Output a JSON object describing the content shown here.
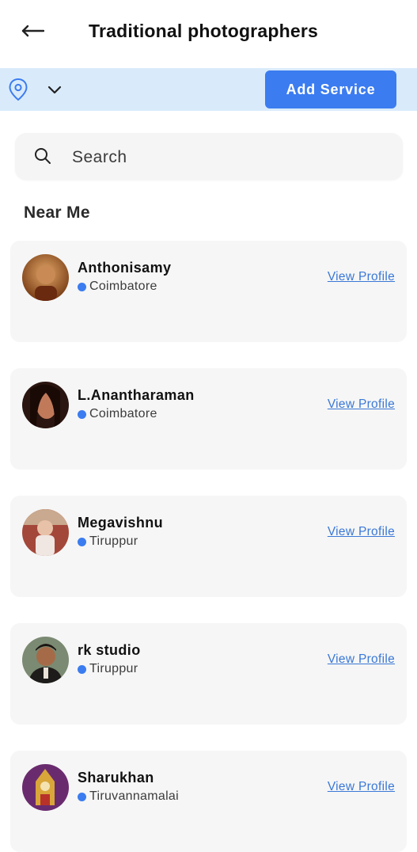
{
  "header": {
    "back_icon": "back-arrow-icon",
    "title": "Traditional photographers"
  },
  "location_bar": {
    "location_icon": "map-pin-icon",
    "dropdown_icon": "chevron-down-icon",
    "add_service_label": "Add Service",
    "background_color": "#d9ebfb",
    "button_color": "#3b7cf0"
  },
  "search": {
    "icon": "search-icon",
    "placeholder": "Search"
  },
  "section": {
    "title": "Near Me"
  },
  "listings": [
    {
      "name": "Anthonisamy",
      "location": "Coimbatore",
      "action": "View Profile",
      "avatar_colors": [
        "#8a4a1e",
        "#d99a55"
      ]
    },
    {
      "name": "L.Anantharaman",
      "location": "Coimbatore",
      "action": "View Profile",
      "avatar_colors": [
        "#2a1510",
        "#c07a5a"
      ]
    },
    {
      "name": "Megavishnu",
      "location": "Tiruppur",
      "action": "View Profile",
      "avatar_colors": [
        "#a3473a",
        "#f0e6e2"
      ]
    },
    {
      "name": "rk studio",
      "location": "Tiruppur",
      "action": "View Profile",
      "avatar_colors": [
        "#5a6b55",
        "#2a2724"
      ]
    },
    {
      "name": "Sharukhan",
      "location": "Tiruvannamalai",
      "action": "View Profile",
      "avatar_colors": [
        "#6a2b6e",
        "#d9a63a"
      ]
    }
  ],
  "accent_colors": {
    "link": "#3a78d6",
    "dot": "#3b7cf0"
  }
}
